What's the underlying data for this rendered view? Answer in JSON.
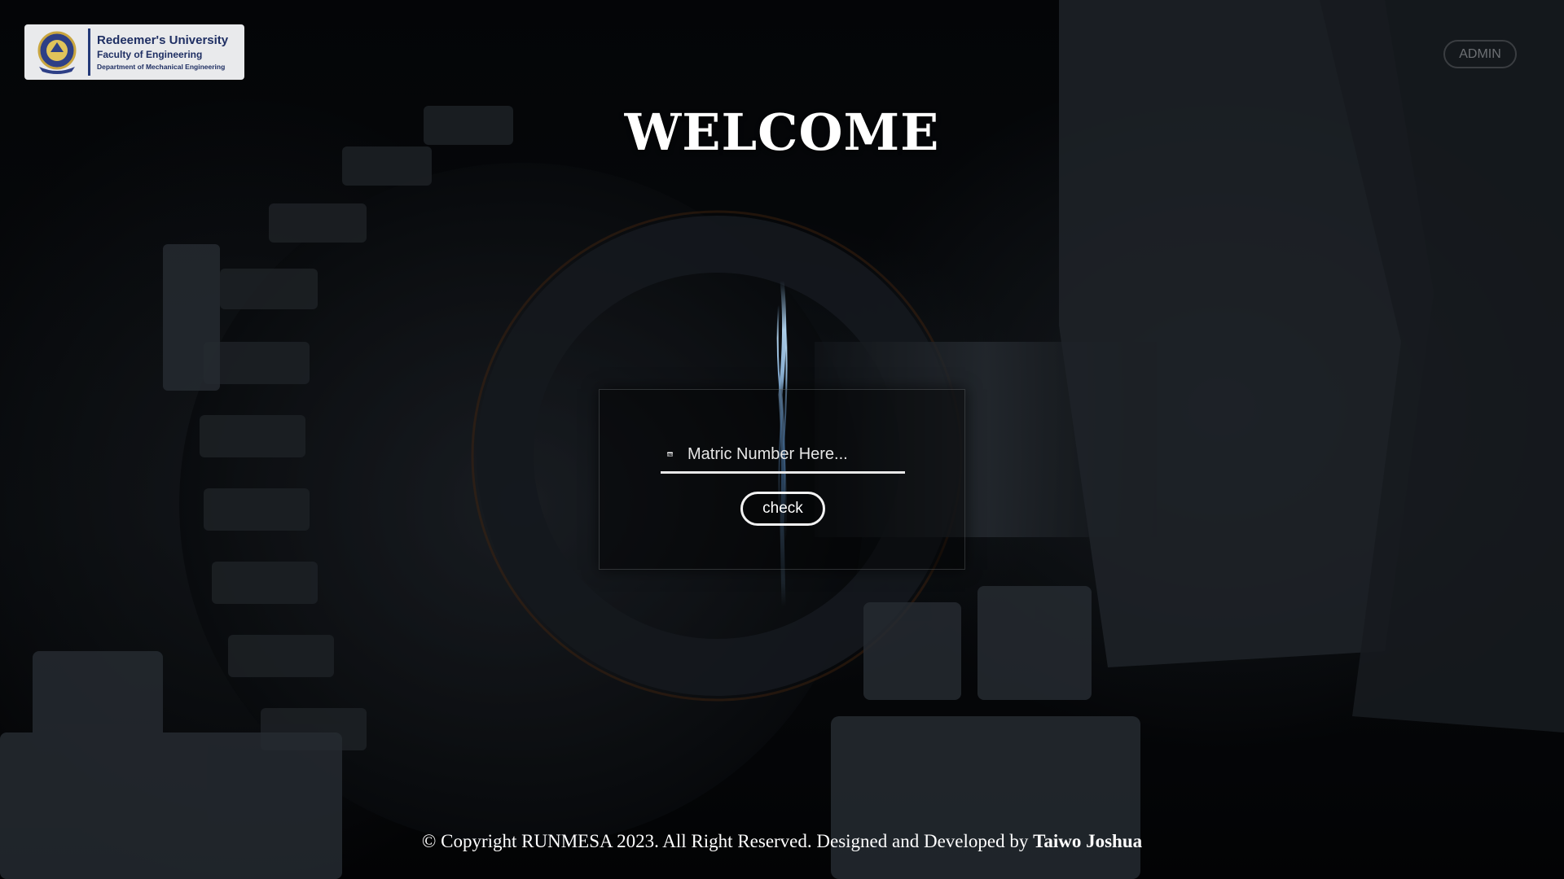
{
  "logo": {
    "university": "Redeemer's University",
    "faculty": "Faculty of Engineering",
    "department": "Department of Mechanical Engineering",
    "seal_icon": "university-seal-icon",
    "accent_color": "#243a78"
  },
  "header": {
    "admin_label": "ADMIN"
  },
  "hero": {
    "title": "WELCOME"
  },
  "form": {
    "id_icon": "id-card-icon",
    "input_placeholder": "Matric Number Here...",
    "input_value": "",
    "check_label": "check"
  },
  "footer": {
    "copyright_text": "© Copyright RUNMESA 2023. All Right Reserved. Designed and Developed by",
    "developer": "Taiwo Joshua"
  }
}
